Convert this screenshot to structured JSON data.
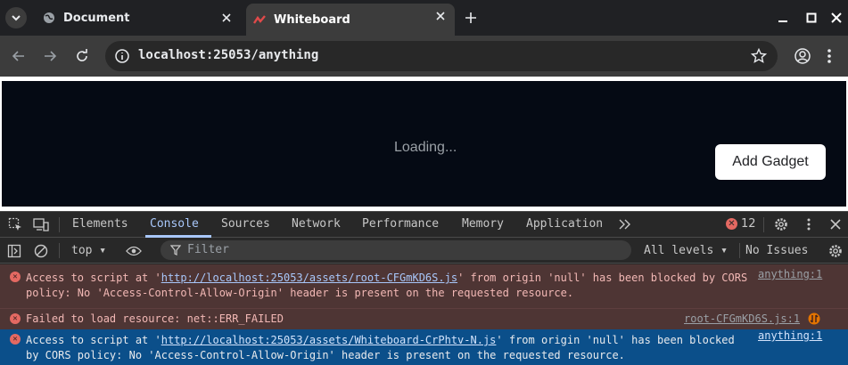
{
  "browser": {
    "tabs": [
      {
        "title": "Document",
        "active": false,
        "favicon": "globe-icon"
      },
      {
        "title": "Whiteboard",
        "active": true,
        "favicon": "whiteboard-logo-icon"
      }
    ],
    "url": "localhost:25053/anything"
  },
  "page": {
    "loading_text": "Loading...",
    "add_gadget_label": "Add Gadget"
  },
  "devtools": {
    "tabs": [
      "Elements",
      "Console",
      "Sources",
      "Network",
      "Performance",
      "Memory",
      "Application"
    ],
    "active_tab": "Console",
    "error_count": "12",
    "context": "top",
    "filter_placeholder": "Filter",
    "levels": "All levels",
    "issues": "No Issues",
    "messages": [
      {
        "prefix": "Access to script at '",
        "link": "http://localhost:25053/assets/root-CFGmKD6S.js",
        "suffix1": "' from origin 'null' has been blocked by CORS",
        "line2": "policy: No 'Access-Control-Allow-Origin' header is present on the requested resource.",
        "source": "anything:1"
      },
      {
        "text": "Failed to load resource: net::ERR_FAILED",
        "source": "root-CFGmKD6S.js:1"
      },
      {
        "prefix": "Access to script at '",
        "link": "http://localhost:25053/assets/Whiteboard-CrPhtv-N.js",
        "suffix1": "' from origin 'null' has been blocked",
        "line2": "by CORS policy: No 'Access-Control-Allow-Origin' header is present on the requested resource.",
        "source": "anything:1"
      }
    ]
  },
  "colors": {
    "error_bg": "#4e3534",
    "selected_bg": "#0b4f8a",
    "accent": "#a8c7fa"
  }
}
